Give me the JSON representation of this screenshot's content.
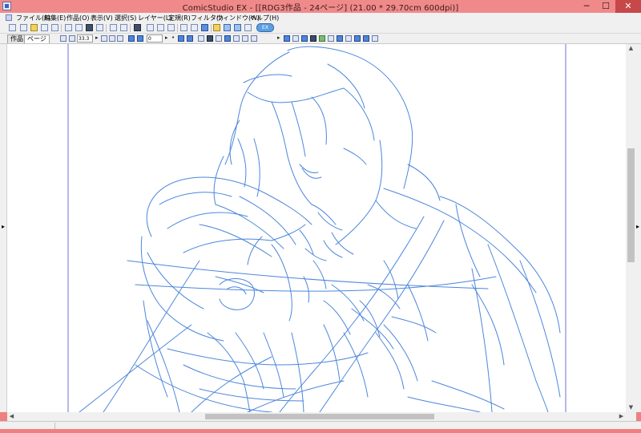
{
  "window": {
    "title": "ComicStudio EX - [[RDG3作品 - 24ページ] (21.00 * 29.70cm 600dpi)]",
    "minimize": "─",
    "maximize": "☐",
    "close": "✕"
  },
  "menu": [
    {
      "label": "ファイル(F)"
    },
    {
      "label": "編集(E)"
    },
    {
      "label": "作品(O)"
    },
    {
      "label": "表示(V)"
    },
    {
      "label": "選択(S)"
    },
    {
      "label": "レイヤー(L)"
    },
    {
      "label": "定規(R)"
    },
    {
      "label": "フィルタ(I)"
    },
    {
      "label": "ウィンドウ(W)"
    },
    {
      "label": "ヘルプ(H)"
    }
  ],
  "toolbar": {
    "badge": "EX",
    "tab_sakuhin": "作品",
    "tab_page": "ページ",
    "tab_close": "✕",
    "zoom_value": "33.3",
    "angle_value": "0"
  },
  "canvas": {
    "background": "#ffffff",
    "line_color": "#3a7ad8",
    "guide_color": "#6f6fd8"
  },
  "colors": {
    "titlebar": "#f08a8a",
    "chrome": "#f0f0f0",
    "close_button": "#c74848"
  }
}
